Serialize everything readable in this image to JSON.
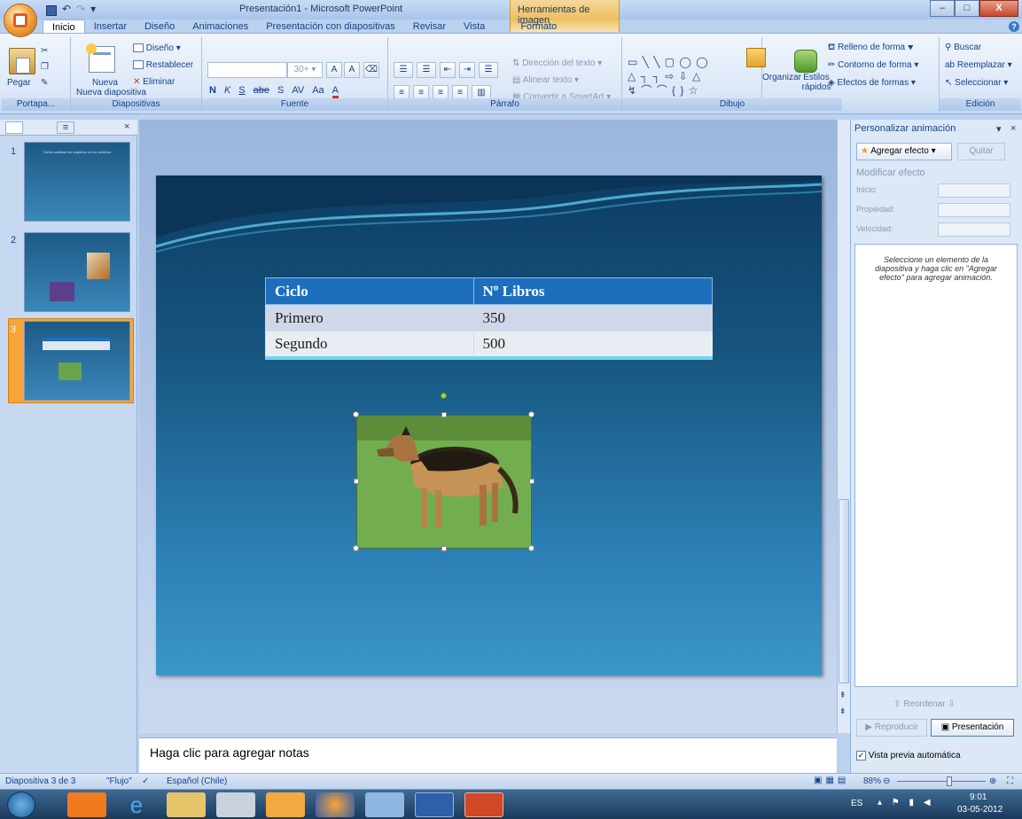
{
  "window": {
    "title": "Presentación1 - Microsoft PowerPoint",
    "context_tab_group": "Herramientas de imagen",
    "min": "–",
    "max": "□",
    "close": "X"
  },
  "tabs": [
    "Inicio",
    "Insertar",
    "Diseño",
    "Animaciones",
    "Presentación con diapositivas",
    "Revisar",
    "Vista",
    "Formato"
  ],
  "ribbon": {
    "portapapeles": {
      "pegar": "Pegar",
      "label": "Portapa..."
    },
    "diapositivas": {
      "nueva": "Nueva diapositiva",
      "diseno": "Diseño",
      "restablecer": "Restablecer",
      "eliminar": "Eliminar",
      "label": "Diapositivas"
    },
    "fuente": {
      "size": "30+",
      "label": "Fuente",
      "bold": "N",
      "italic": "K",
      "underline": "S",
      "strike": "abe",
      "shadow": "S",
      "spacing": "AV",
      "case": "Aa",
      "color": "A"
    },
    "parrafo": {
      "direccion": "Dirección del texto",
      "alinear": "Alinear texto",
      "smartart": "Convertir a SmartArt",
      "label": "Párrafo"
    },
    "dibujo": {
      "organizar": "Organizar",
      "estilos": "Estilos rápidos",
      "relleno": "Relleno de forma",
      "contorno": "Contorno de forma",
      "efectos": "Efectos de formas",
      "label": "Dibujo"
    },
    "edicion": {
      "buscar": "Buscar",
      "reemplazar": "Reemplazar",
      "seleccionar": "Seleccionar",
      "label": "Edición"
    }
  },
  "thumbnails": [
    {
      "num": "1",
      "text": "Cierta cantidad de registros en los archivos"
    },
    {
      "num": "2"
    },
    {
      "num": "3",
      "selected": true
    }
  ],
  "slide_table": {
    "headers": [
      "Ciclo",
      "Nº Libros"
    ],
    "rows": [
      [
        "Primero",
        "350"
      ],
      [
        "Segundo",
        "500"
      ]
    ]
  },
  "notes_placeholder": "Haga clic para agregar notas",
  "animation_panel": {
    "title": "Personalizar animación",
    "add_effect": "Agregar efecto",
    "remove": "Quitar",
    "modify": "Modificar efecto",
    "inicio": "Inicio:",
    "propiedad": "Propiedad:",
    "velocidad": "Velocidad:",
    "hint": "Seleccione un elemento de la diapositiva y haga clic en \"Agregar efecto\" para agregar animación.",
    "reordenar": "Reordenar",
    "reproducir": "Reproducir",
    "presentacion": "Presentación",
    "vista_previa": "Vista previa automática"
  },
  "status": {
    "slide": "Diapositiva 3 de 3",
    "theme": "\"Flujo\"",
    "language": "Español (Chile)",
    "zoom": "88%"
  },
  "taskbar": {
    "lang": "ES",
    "time": "9:01",
    "date": "03-05-2012"
  }
}
